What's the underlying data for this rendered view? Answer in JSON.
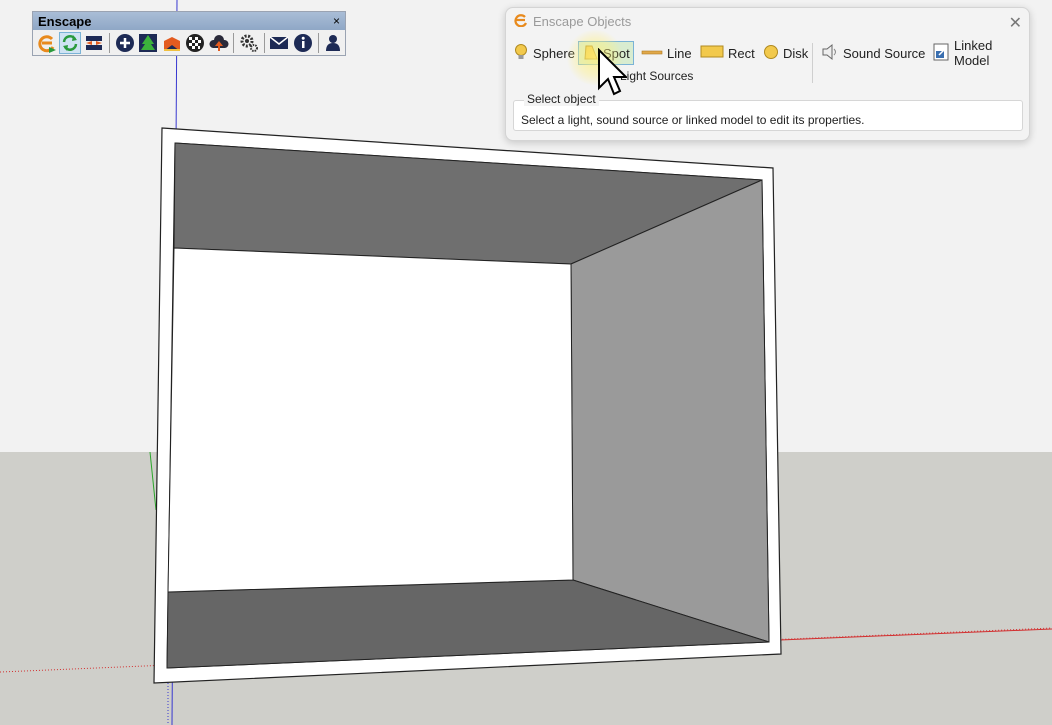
{
  "enscape_toolbar": {
    "title": "Enscape",
    "close_glyph": "×",
    "buttons": [
      {
        "name": "start-enscape-icon",
        "color": "#e88a1d"
      },
      {
        "name": "live-update-icon",
        "color": "#2a9a3d"
      },
      {
        "name": "sync-views-icon",
        "color": "#3a3a3a"
      },
      {
        "name": "add-view-icon",
        "color": "#1d2a55"
      },
      {
        "name": "asset-library-icon",
        "color": "#2a8a2a"
      },
      {
        "name": "material-editor-icon",
        "color": "#e35b1f"
      },
      {
        "name": "panorama-icon",
        "color": "#222222"
      },
      {
        "name": "web-upload-icon",
        "color": "#2a2a3a"
      },
      {
        "name": "settings-icon",
        "color": "#333333"
      },
      {
        "name": "feedback-icon",
        "color": "#1d2a55"
      },
      {
        "name": "about-icon",
        "color": "#1d2a55"
      },
      {
        "name": "account-icon",
        "color": "#1d2a55"
      }
    ]
  },
  "objects_panel": {
    "title": "Enscape Objects",
    "close_glyph": "✕",
    "tools": {
      "sphere": "Sphere",
      "spot": "Spot",
      "line": "Line",
      "rect": "Rect",
      "disk": "Disk",
      "sound_source": "Sound Source",
      "linked_model": "Linked Model"
    },
    "group_label": "Light Sources",
    "property_legend": "Select object",
    "property_text": "Select a light, sound source or linked model to edit its properties."
  },
  "colors": {
    "sky": "#f2f2f2",
    "ground": "#cfcfca",
    "accent": "#e88a1d",
    "active_tool_fill": "#d8ecd0",
    "active_tool_border": "#7ab3d6"
  }
}
